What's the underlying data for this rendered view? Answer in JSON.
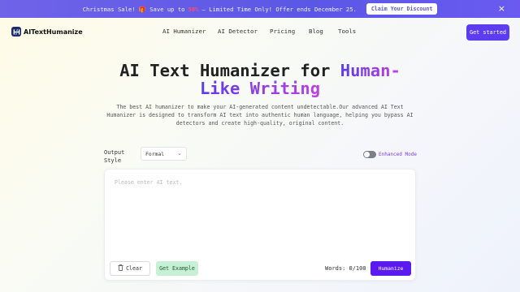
{
  "banner": {
    "text_before": "Christmas Sale! 🎁 Save up to",
    "discount": "50%",
    "text_after": "– Limited Time Only! Offer ends December 25.",
    "claim_label": "Claim Your Discount",
    "close_symbol": "×"
  },
  "nav": {
    "brand": "AITextHumanize",
    "links": [
      "AI Humanizer",
      "AI Detector",
      "Pricing",
      "Blog",
      "Tools"
    ],
    "cta": "Get started"
  },
  "hero": {
    "title_plain": "AI Text Humanizer for",
    "title_highlight_1": "Human-",
    "title_highlight_2": "Like Writing",
    "description": "The best AI humanizer to make your AI-generated content undetectable.Our advanced AI Text Humanizer is designed to transform AI text into authentic human language, helping you bypass AI detectors and create high-quality, original content."
  },
  "controls": {
    "output_style_label": "Output Style",
    "output_style_value": "Formal",
    "enhanced_mode_label": "Enhanced Mode",
    "enhanced_mode_on": false
  },
  "editor": {
    "placeholder": "Please enter AI text.",
    "clear_label": "Clear",
    "example_label": "Get Example",
    "words_label": "Words: 0/100",
    "humanize_label": "Humanize"
  },
  "colors": {
    "banner_bg": "#5b57e6",
    "accent": "#5b3cf0",
    "highlight_gradient_end": "#c040e0",
    "example_bg": "#c8f0d4"
  }
}
